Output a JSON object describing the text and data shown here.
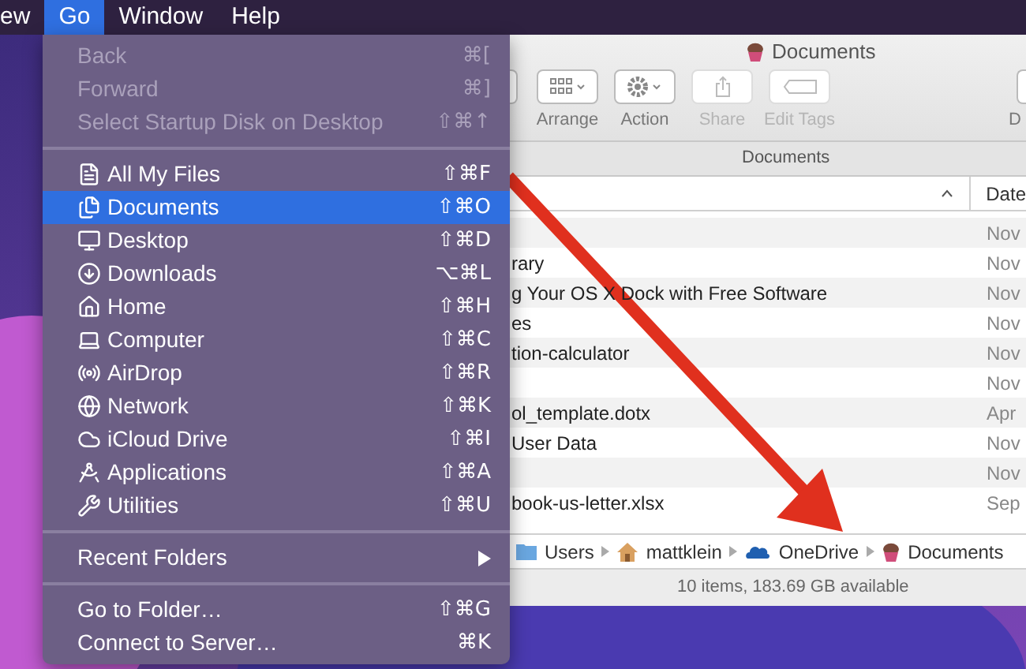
{
  "menu_bar": {
    "items": [
      {
        "label": "ew",
        "selected": false
      },
      {
        "label": "Go",
        "selected": true
      },
      {
        "label": "Window",
        "selected": false
      },
      {
        "label": "Help",
        "selected": false
      }
    ]
  },
  "go_menu": {
    "groups": [
      {
        "items": [
          {
            "label": "Back",
            "shortcut": "⌘[",
            "kind": "plain",
            "disabled": true,
            "selected": false
          },
          {
            "label": "Forward",
            "shortcut": "⌘]",
            "kind": "plain",
            "disabled": true,
            "selected": false
          },
          {
            "label": "Select Startup Disk on Desktop",
            "shortcut": "⇧⌘↑",
            "kind": "plain",
            "disabled": true,
            "selected": false
          }
        ]
      },
      {
        "items": [
          {
            "label": "All My Files",
            "shortcut": "⇧⌘F",
            "kind": "place",
            "disabled": false,
            "selected": false
          },
          {
            "label": "Documents",
            "shortcut": "⇧⌘O",
            "kind": "place",
            "disabled": false,
            "selected": true
          },
          {
            "label": "Desktop",
            "shortcut": "⇧⌘D",
            "kind": "place",
            "disabled": false,
            "selected": false
          },
          {
            "label": "Downloads",
            "shortcut": "⌥⌘L",
            "kind": "place",
            "disabled": false,
            "selected": false
          },
          {
            "label": "Home",
            "shortcut": "⇧⌘H",
            "kind": "place",
            "disabled": false,
            "selected": false
          },
          {
            "label": "Computer",
            "shortcut": "⇧⌘C",
            "kind": "place",
            "disabled": false,
            "selected": false
          },
          {
            "label": "AirDrop",
            "shortcut": "⇧⌘R",
            "kind": "place",
            "disabled": false,
            "selected": false
          },
          {
            "label": "Network",
            "shortcut": "⇧⌘K",
            "kind": "place",
            "disabled": false,
            "selected": false
          },
          {
            "label": "iCloud Drive",
            "shortcut": "⇧⌘I",
            "kind": "place",
            "disabled": false,
            "selected": false
          },
          {
            "label": "Applications",
            "shortcut": "⇧⌘A",
            "kind": "place",
            "disabled": false,
            "selected": false
          },
          {
            "label": "Utilities",
            "shortcut": "⇧⌘U",
            "kind": "place",
            "disabled": false,
            "selected": false
          }
        ]
      },
      {
        "items": [
          {
            "label": "Recent Folders",
            "kind": "submenu",
            "disabled": false,
            "selected": false
          }
        ]
      },
      {
        "items": [
          {
            "label": "Go to Folder…",
            "shortcut": "⇧⌘G",
            "kind": "plain",
            "disabled": false,
            "selected": false
          },
          {
            "label": "Connect to Server…",
            "shortcut": "⌘K",
            "kind": "plain",
            "disabled": false,
            "selected": false
          }
        ]
      }
    ]
  },
  "finder": {
    "title": "Documents",
    "toolbar": [
      {
        "kind": "cut",
        "disabled": false
      },
      {
        "label": "Arrange",
        "kind": "arrange",
        "disabled": false
      },
      {
        "label": "Action",
        "kind": "action",
        "disabled": false
      },
      {
        "label": "Share",
        "kind": "share",
        "disabled": true
      },
      {
        "label": "Edit Tags",
        "kind": "tags",
        "disabled": true
      },
      {
        "label": "D",
        "kind": "cut-right",
        "disabled": false
      }
    ],
    "tab": "Documents",
    "columns": [
      {
        "kind": "name",
        "sorted": true
      },
      {
        "kind": "date",
        "label": "Date",
        "sorted": false
      }
    ],
    "rows": [
      {
        "date": "Nov"
      },
      {
        "name": "rary",
        "date": "Nov"
      },
      {
        "name": "g Your OS X Dock with Free Software",
        "date": "Nov"
      },
      {
        "name": "es",
        "date": "Nov"
      },
      {
        "name": "tion-calculator",
        "date": "Nov"
      },
      {
        "date": "Nov"
      },
      {
        "name": "ol_template.dotx",
        "date": "Apr"
      },
      {
        "name": "User Data",
        "date": "Nov"
      },
      {
        "date": "Nov"
      },
      {
        "name": "book-us-letter.xlsx",
        "date": "Sep"
      }
    ],
    "path": [
      {
        "label": "Users",
        "kind": "folder"
      },
      {
        "label": "mattklein",
        "kind": "home"
      },
      {
        "label": "OneDrive",
        "kind": "cloud"
      },
      {
        "label": "Documents",
        "kind": "cupcake"
      }
    ],
    "status": "10 items, 183.69 GB available"
  }
}
